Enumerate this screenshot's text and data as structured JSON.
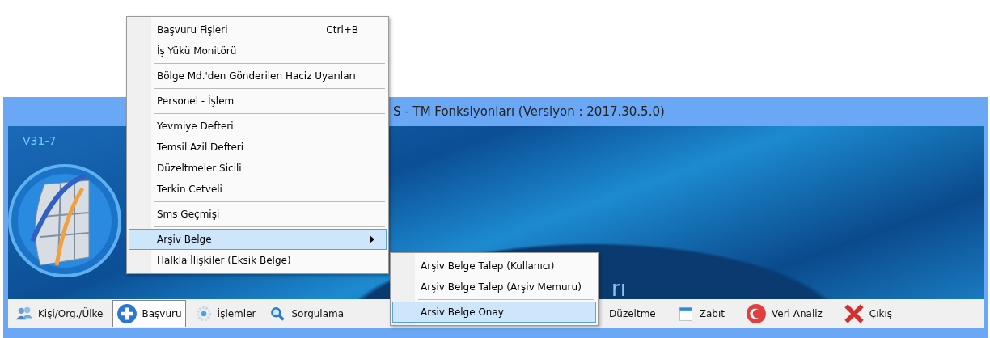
{
  "window": {
    "title": "S - TM Fonksiyonları  (Versiyon : 2017.30.5.0)"
  },
  "banner": {
    "version_link": "V31-7",
    "caption": "rı"
  },
  "menu": {
    "items": [
      {
        "kind": "item",
        "label": "Başvuru Fişleri",
        "shortcut": "Ctrl+B",
        "selected": false
      },
      {
        "kind": "item",
        "label": "İş Yükü Monitörü",
        "selected": false
      },
      {
        "kind": "separator"
      },
      {
        "kind": "item",
        "label": "Bölge Md.'den Gönderilen Haciz Uyarıları",
        "selected": false
      },
      {
        "kind": "separator"
      },
      {
        "kind": "item",
        "label": "Personel - İşlem",
        "selected": false
      },
      {
        "kind": "separator"
      },
      {
        "kind": "item",
        "label": "Yevmiye Defteri",
        "selected": false
      },
      {
        "kind": "item",
        "label": "Temsil Azil Defteri",
        "selected": false
      },
      {
        "kind": "item",
        "label": "Düzeltmeler Sicili",
        "selected": false
      },
      {
        "kind": "item",
        "label": "Terkin Cetveli",
        "selected": false
      },
      {
        "kind": "separator"
      },
      {
        "kind": "item",
        "label": "Sms Geçmişi",
        "selected": false
      },
      {
        "kind": "separator"
      },
      {
        "kind": "submenu",
        "label": "Arşiv Belge",
        "selected": true
      },
      {
        "kind": "item",
        "label": "Halkla İlişkiler (Eksik Belge)",
        "selected": false
      }
    ]
  },
  "submenu": {
    "items": [
      {
        "kind": "item",
        "label": "Arşiv Belge Talep (Kullanıcı)",
        "selected": false
      },
      {
        "kind": "item",
        "label": "Arşiv Belge Talep (Arşiv Memuru)",
        "selected": false
      },
      {
        "kind": "separator"
      },
      {
        "kind": "item",
        "label": "Arsiv Belge Onay",
        "selected": true
      }
    ]
  },
  "toolbar": {
    "left": [
      {
        "label": "Kişi/Org./Ülke",
        "selected": false
      },
      {
        "label": "Başvuru",
        "selected": true
      },
      {
        "label": "İşlemler",
        "selected": false
      },
      {
        "label": "Sorgulama",
        "selected": false
      }
    ],
    "right": [
      {
        "label": "Düzeltme",
        "selected": false
      },
      {
        "label": "Zabıt",
        "selected": false
      },
      {
        "label": "Veri Analiz",
        "selected": false
      },
      {
        "label": "Çıkış",
        "selected": false
      }
    ]
  }
}
